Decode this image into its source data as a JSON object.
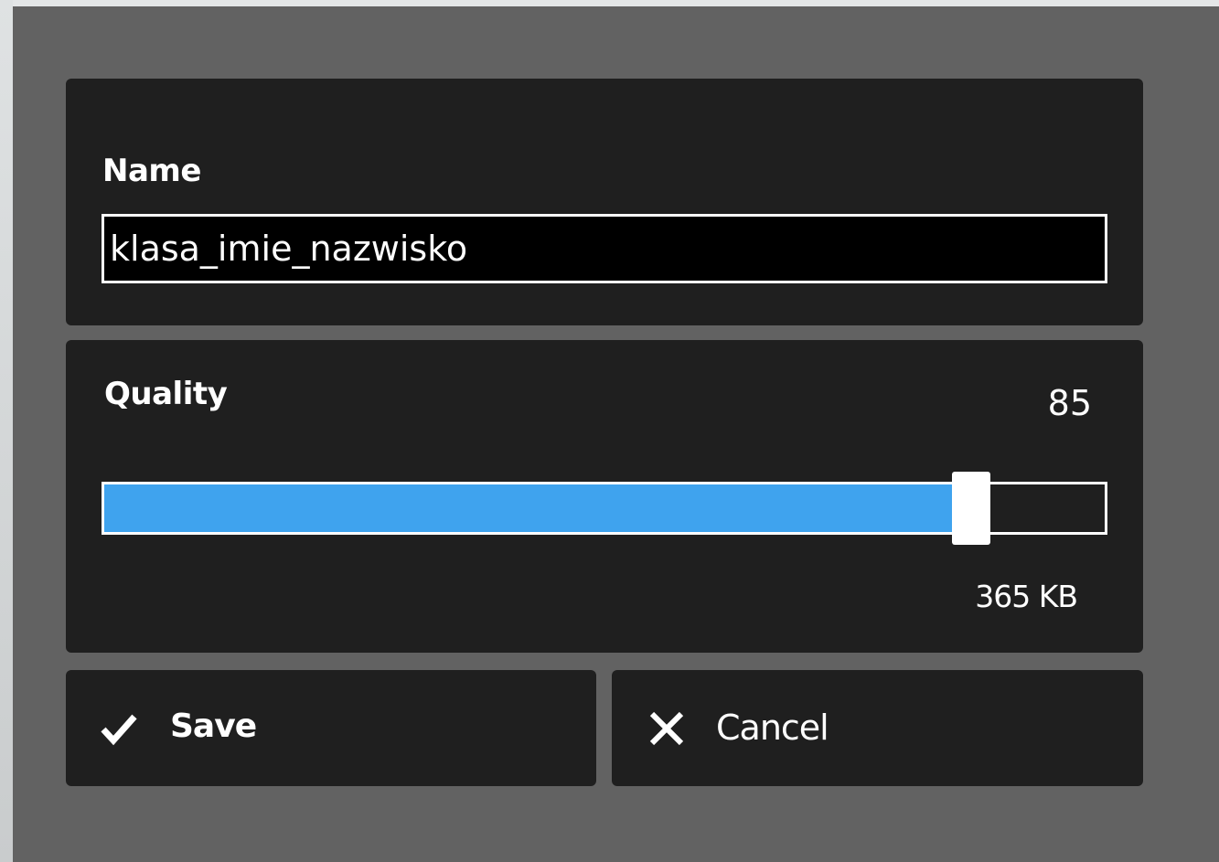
{
  "form": {
    "name_label": "Name",
    "name_value": "klasa_imie_nazwisko",
    "quality_label": "Quality",
    "quality_value": "85",
    "quality_fraction": 0.85,
    "file_size": "365 KB"
  },
  "buttons": {
    "save_label": "Save",
    "save_icon": "checkmark-icon",
    "cancel_label": "Cancel",
    "cancel_icon": "close-icon"
  },
  "colors": {
    "accent": "#3fa3ee",
    "panel": "#1f1f1f",
    "backdrop": "#626262"
  }
}
